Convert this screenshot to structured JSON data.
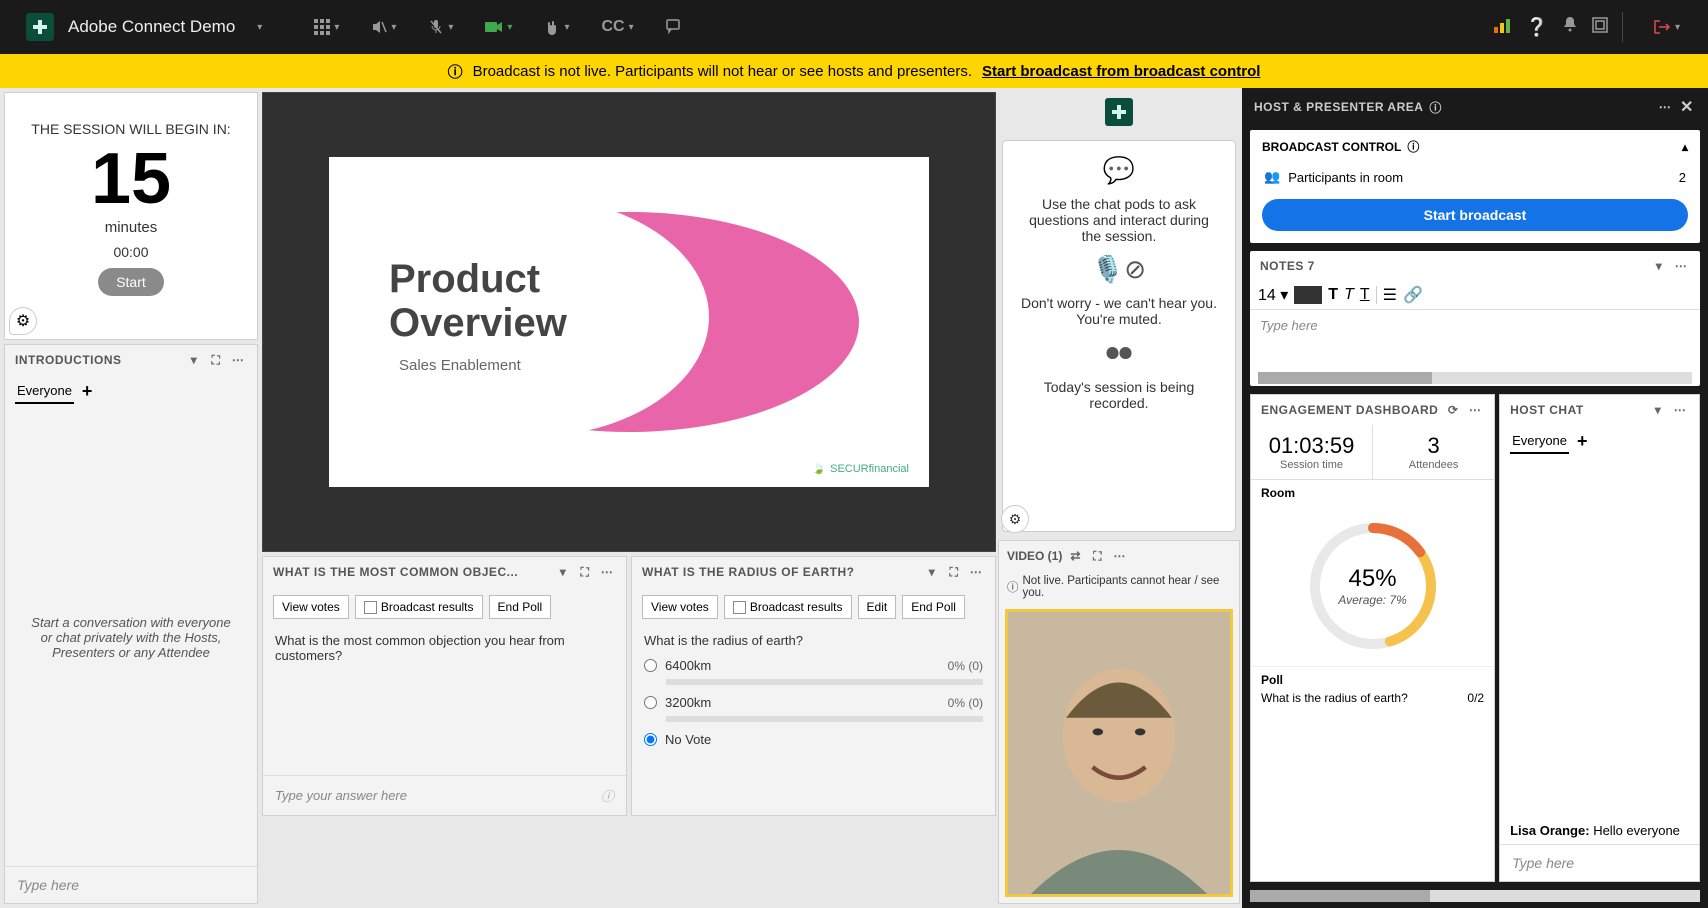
{
  "topbar": {
    "app_title": "Adobe Connect Demo",
    "cc_label": "CC"
  },
  "banner": {
    "info_icon": "ⓘ",
    "text": "Broadcast is not live. Participants will not hear or see hosts and presenters.",
    "link": "Start broadcast from broadcast control"
  },
  "timer": {
    "label": "THE SESSION WILL BEGIN IN:",
    "value": "15",
    "unit": "minutes",
    "clock": "00:00",
    "start": "Start"
  },
  "introductions": {
    "title": "INTRODUCTIONS",
    "tab": "Everyone",
    "placeholder_body": "Start a conversation with everyone or chat privately with the Hosts, Presenters or any Attendee",
    "input_placeholder": "Type here"
  },
  "slide": {
    "title_line1": "Product",
    "title_line2": "Overview",
    "subtitle": "Sales Enablement",
    "brand": "SECURfinancial"
  },
  "poll1": {
    "title": "WHAT IS THE MOST COMMON OBJEC...",
    "view_votes": "View votes",
    "broadcast": "Broadcast results",
    "end": "End Poll",
    "question": "What is the most common objection you hear from customers?",
    "answer_placeholder": "Type your answer here"
  },
  "poll2": {
    "title": "WHAT IS THE RADIUS OF EARTH?",
    "view_votes": "View votes",
    "broadcast": "Broadcast results",
    "edit": "Edit",
    "end": "End Poll",
    "question": "What is the radius of earth?",
    "opt1": "6400km",
    "opt1_pct": "0% (0)",
    "opt2": "3200km",
    "opt2_pct": "0% (0)",
    "opt3": "No Vote"
  },
  "lobby": {
    "msg1": "Use the chat pods to ask questions and interact during the session.",
    "msg2": "Don't worry - we can't hear you. You're muted.",
    "msg3": "Today's session is being recorded."
  },
  "video": {
    "title": "VIDEO (1)",
    "notice": "Not live. Participants cannot hear / see you."
  },
  "host_area": {
    "title": "HOST & PRESENTER AREA"
  },
  "broadcast_control": {
    "title": "BROADCAST CONTROL",
    "participants_label": "Participants in room",
    "participants_count": "2",
    "button": "Start broadcast"
  },
  "notes": {
    "title": "NOTES 7",
    "font_size": "14",
    "placeholder": "Type here"
  },
  "engagement": {
    "title": "ENGAGEMENT DASHBOARD",
    "session_time": "01:03:59",
    "session_time_label": "Session time",
    "attendees": "3",
    "attendees_label": "Attendees",
    "room_label": "Room",
    "percent": "45%",
    "average": "Average: 7%",
    "poll_label": "Poll",
    "poll_q": "What is the radius of earth?",
    "poll_count": "0/2"
  },
  "host_chat": {
    "title": "HOST CHAT",
    "tab": "Everyone",
    "sender": "Lisa Orange:",
    "message": "Hello everyone",
    "placeholder": "Type here"
  }
}
